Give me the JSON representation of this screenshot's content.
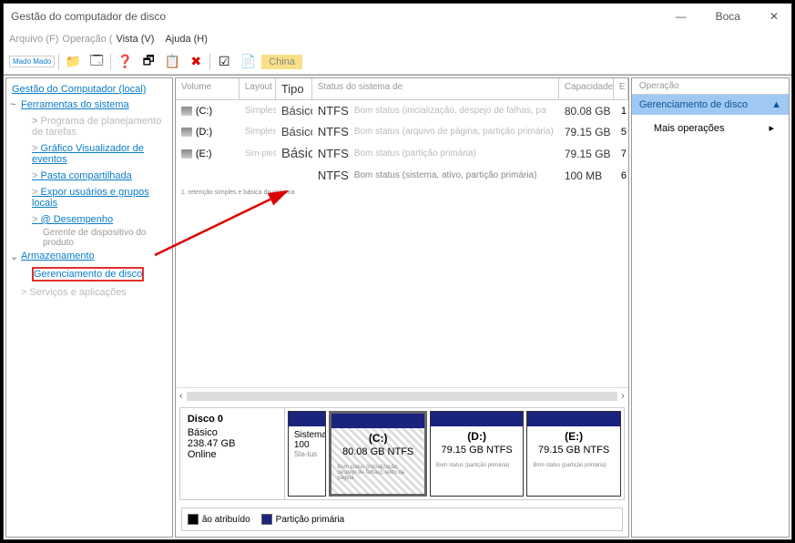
{
  "window": {
    "title": "Gestão do computador de disco",
    "user": "Boca",
    "minimize": "—",
    "close": "✕"
  },
  "menu": {
    "arquivo": "Arquivo (F)",
    "operacao": "Operação (",
    "vista": "Vista (V)",
    "ajuda": "Ajuda (H)"
  },
  "toolbar": {
    "mado": "Mado Mado",
    "china": "China"
  },
  "tree": {
    "root": "Gestão do Computador (local)",
    "sys_tools": "Ferramentas do sistema",
    "task_plan": "Programa de planejamento de tarefas",
    "event_viewer": "Gráfico Visualizador de eventos",
    "shared_folder": "Pasta compartilhada",
    "users_groups": "Expor usuários e grupos locais",
    "performance": "@ Desempenho",
    "device_mgr": "Gerente de dispositivo do produto",
    "storage": "Armazenamento",
    "disk_mgmt": "Gerenciamento de disco",
    "services": "Serviços e aplicações"
  },
  "table": {
    "headers": {
      "volume": "Volume",
      "layout": "Layout",
      "tipo": "Tipo",
      "status": "Status do sistema de",
      "capacidade": "Capacidade",
      "e": "E"
    },
    "rows": [
      {
        "vol": "(C:)",
        "layout": "Simples",
        "tipo": "Básico",
        "fs": "NTFS",
        "status": "Bom status (inicialização, despejo de falhas, pa",
        "cap": "80.08 GB",
        "e": "1"
      },
      {
        "vol": "(D:)",
        "layout": "Simples",
        "tipo": "Básico",
        "fs": "NTFS",
        "status": "Bom status (arquivo de página, partição primária)",
        "cap": "79.15 GB",
        "e": "5"
      },
      {
        "vol": "(E:)",
        "layout": "Sim-ples",
        "tipo": "Básico",
        "fs": "NTFS",
        "status": "Bom status (partição primária)",
        "cap": "79.15 GB",
        "e": "7"
      },
      {
        "vol": "",
        "layout": "",
        "tipo": "",
        "fs": "NTFS",
        "status": "Bom status (sistema, ativo, partição primária)",
        "cap": "100 MB",
        "e": "6"
      }
    ],
    "footnote": "1. retenção simples e básica do sistema"
  },
  "disk": {
    "name": "Disco 0",
    "type": "Básico",
    "size": "238.47 GB",
    "state": "Online",
    "parts": [
      {
        "name": "Sistema",
        "size": "100",
        "extra": "Sta-tus",
        "status": ""
      },
      {
        "name": "(C:)",
        "size": "80.08 GB NTFS",
        "status": "Bom status (inicialização, despejo de falhas), texto da página"
      },
      {
        "name": "(D:)",
        "size": "79.15 GB NTFS",
        "status": "Bom status (partição primária)"
      },
      {
        "name": "(E:)",
        "size": "79.15 GB NTFS",
        "status": "Bom status (partição primária)"
      }
    ]
  },
  "legend": {
    "unallocated": "ão atribuído",
    "primary": "Partição primária"
  },
  "actions": {
    "header": "Operação",
    "main": "Gerenciamento de disco",
    "more": "Mais operações"
  }
}
